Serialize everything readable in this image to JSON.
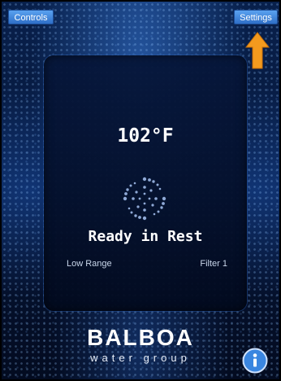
{
  "header": {
    "controls_label": "Controls",
    "settings_label": "Settings"
  },
  "status_panel": {
    "temperature": "102°F",
    "mode": "Ready in Rest",
    "range": "Low Range",
    "filter": "Filter 1"
  },
  "branding": {
    "name": "BALBOA",
    "subtitle": "water group"
  },
  "icons": {
    "arrow": "up-arrow-icon",
    "activity": "swirl-icon",
    "info": "info-icon"
  },
  "colors": {
    "button_blue": "#3b7fd6",
    "arrow_orange": "#f39a1e",
    "background": "#061638",
    "text": "#ffffff"
  }
}
